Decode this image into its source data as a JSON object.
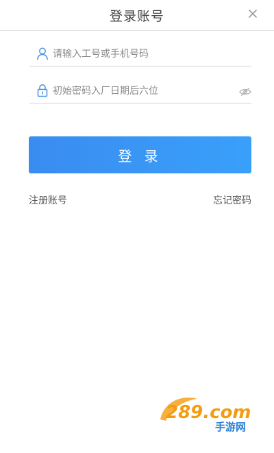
{
  "header": {
    "title": "登录账号",
    "close_icon": "close-icon"
  },
  "form": {
    "username": {
      "placeholder": "请输入工号或手机号码",
      "value": "",
      "icon": "user-icon"
    },
    "password": {
      "placeholder": "初始密码入厂日期后六位",
      "value": "",
      "icon": "lock-icon",
      "toggle_icon": "eye-icon"
    },
    "submit_label": "登 录"
  },
  "links": {
    "register": "注册账号",
    "forgot": "忘记密码"
  },
  "watermark": {
    "brand_text": "289.com",
    "sub_text": "手游网"
  },
  "colors": {
    "primary_button": "#3a93f5",
    "input_underline": "#d4d4d4",
    "icon_blue": "#4a90e2"
  }
}
